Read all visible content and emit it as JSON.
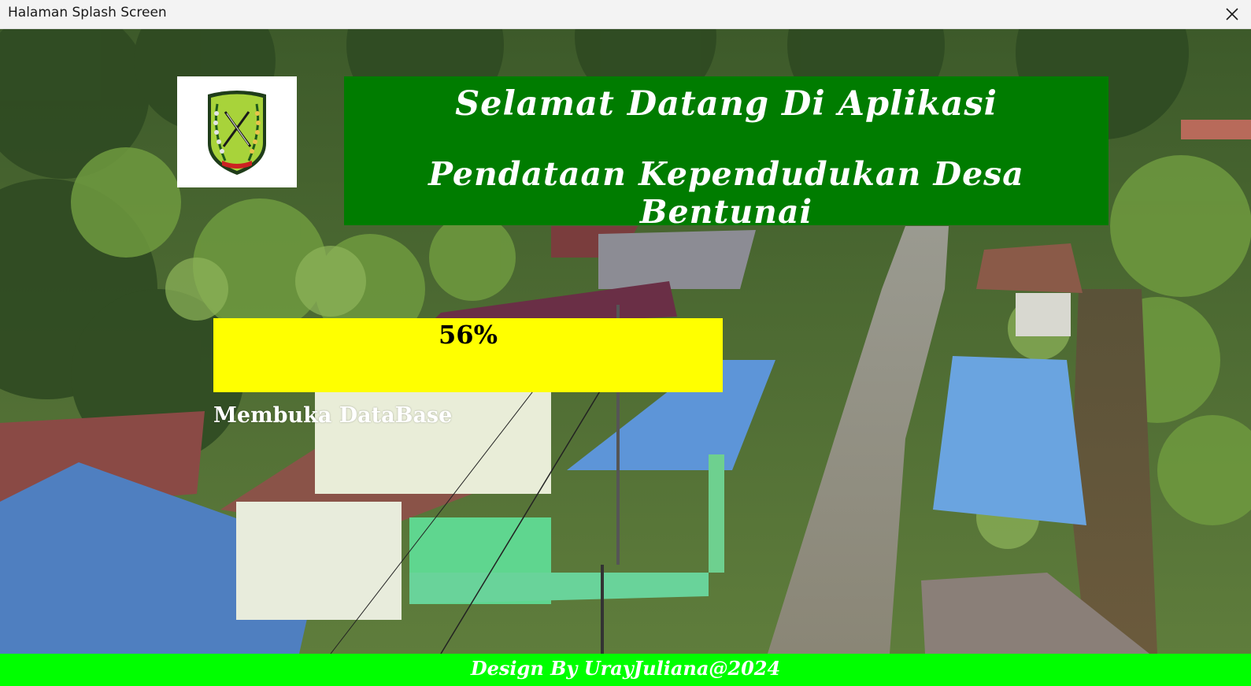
{
  "window": {
    "title": "Halaman Splash Screen",
    "close_icon": "close-icon"
  },
  "background": {
    "description_icon": "village-aerial-photo"
  },
  "logo": {
    "icon": "regency-emblem-icon"
  },
  "banner": {
    "line1": "Selamat Datang Di Aplikasi",
    "line2": "Pendataan Kependudukan Desa Bentunai",
    "color": "#007c00"
  },
  "progress": {
    "value": 56,
    "label": "56%",
    "color": "#ffff00"
  },
  "status": {
    "text": "Membuka DataBase"
  },
  "footer": {
    "text": "Design By UrayJuliana@2024",
    "color": "#00ff00"
  }
}
